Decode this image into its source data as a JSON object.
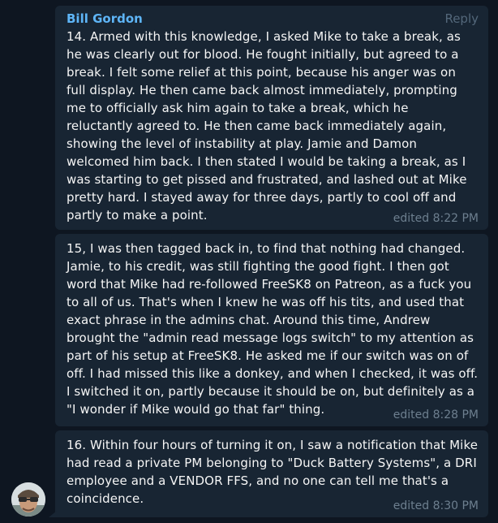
{
  "sender": {
    "name": "Bill Gordon",
    "avatar_icon": "user-avatar-icon"
  },
  "actions": {
    "reply_label": "Reply"
  },
  "messages": [
    {
      "text": "14. Armed with this knowledge, I asked Mike to take a break, as he was clearly out for blood. He fought initially, but agreed to a break. I felt some relief at this point, because his anger was on full display. He then came back almost immediately, prompting me to officially ask him again to take a break, which he reluctantly agreed to. He then came back immediately again, showing the level of instability at play. Jamie and Damon welcomed him back. I then stated I would be taking a break, as I was starting to get pissed and frustrated, and lashed out at Mike pretty hard.  I stayed away for three days, partly to cool off and partly to make a point.",
      "meta": "edited 8:22 PM"
    },
    {
      "text": "15, I was then tagged back in, to find that nothing had changed. Jamie, to his credit, was still fighting the good fight. I then got word that Mike had re-followed FreeSK8 on Patreon, as a fuck you to all of us. That's when I knew he was off his tits, and used that exact phrase in the admins chat. Around this time, Andrew brought the \"admin read message logs switch\" to my attention as part of his setup at FreeSK8. He asked me if our switch was on of off. I had missed this like a donkey, and when I checked, it was off. I switched it on, partly because it should be on, but definitely as a \"I wonder if Mike would go that far\" thing.",
      "meta": "edited 8:28 PM"
    },
    {
      "text": "16. Within four hours of turning it on, I saw a notification that Mike had read a private PM belonging to \"Duck Battery Systems\", a DRI employee and a VENDOR FFS, and no one can tell me that's a coincidence.",
      "meta": "edited 8:30 PM"
    }
  ],
  "colors": {
    "background": "#0e1621",
    "bubble": "#182533",
    "sender_name": "#5eb5f7",
    "text": "#f5f5f5",
    "meta": "#6d7f8f"
  }
}
